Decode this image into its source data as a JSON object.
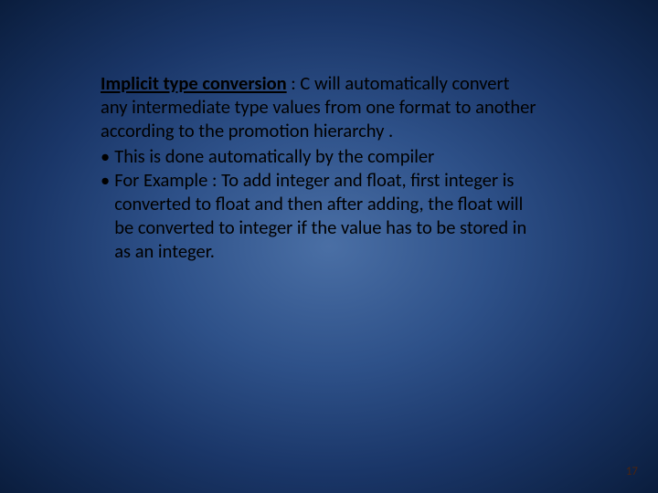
{
  "slide": {
    "heading_term": "Implicit type conversion",
    "heading_rest": " : C will automatically convert any intermediate type values from one format to another according to the promotion hierarchy .",
    "bullet1": "This is done automatically by the compiler",
    "bullet2": "For Example : To add integer and float, first integer is converted to float and then after adding, the float will be converted to integer if the value has to be stored in as an integer."
  },
  "page_number": "17"
}
